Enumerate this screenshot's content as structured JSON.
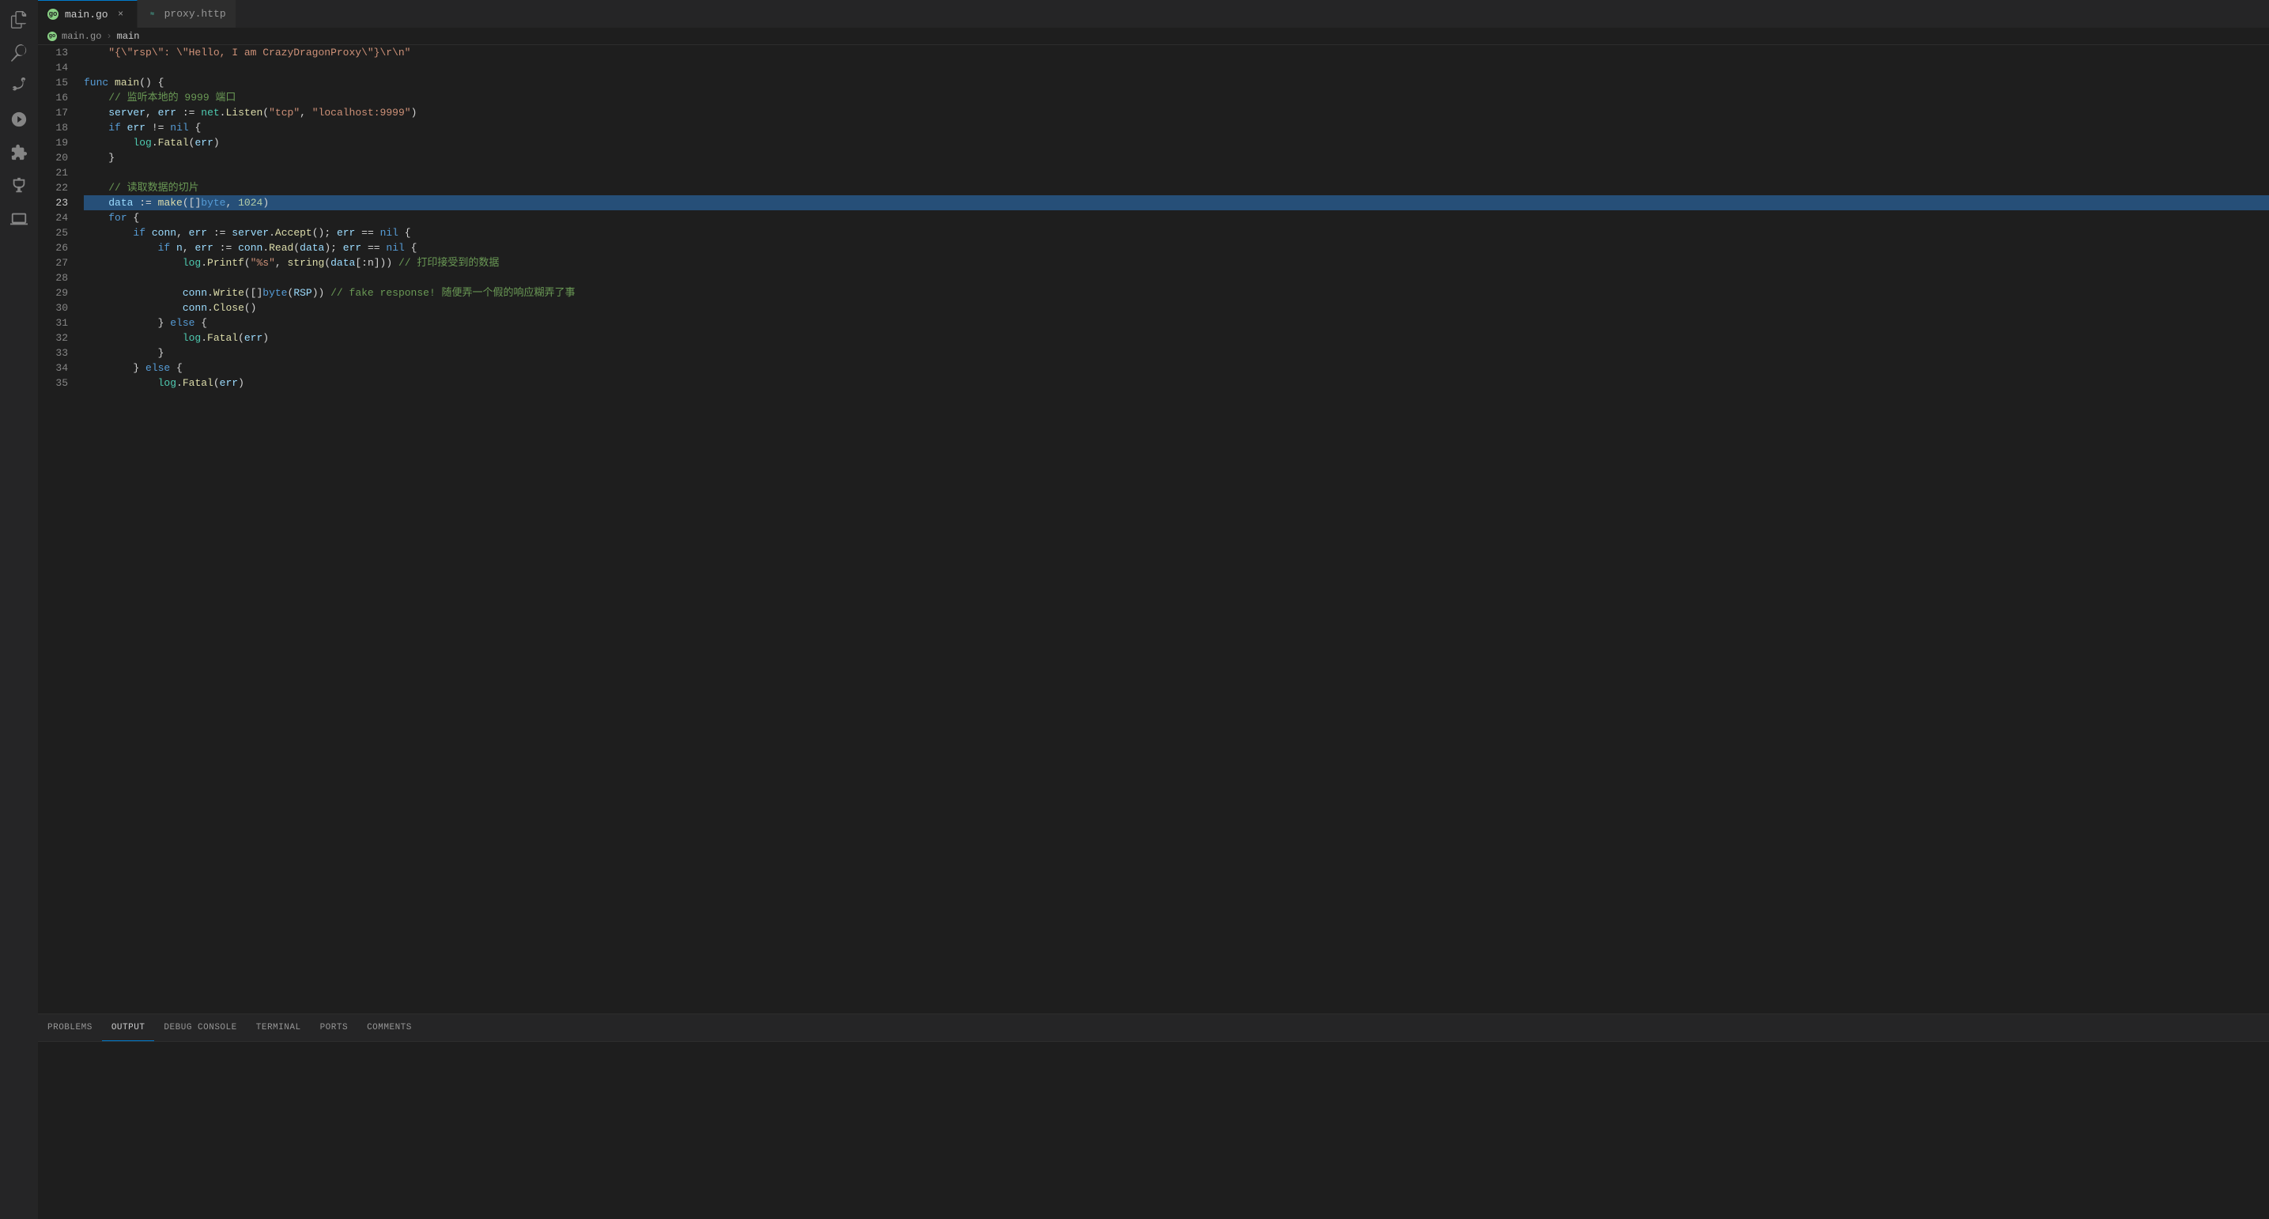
{
  "activityBar": {
    "icons": [
      {
        "name": "files-icon",
        "label": "Explorer",
        "active": false
      },
      {
        "name": "search-icon",
        "label": "Search",
        "active": false
      },
      {
        "name": "source-control-icon",
        "label": "Source Control",
        "active": false
      },
      {
        "name": "run-icon",
        "label": "Run and Debug",
        "active": false
      },
      {
        "name": "extensions-icon",
        "label": "Extensions",
        "active": false
      },
      {
        "name": "testing-icon",
        "label": "Testing",
        "active": false
      },
      {
        "name": "remote-icon",
        "label": "Remote Explorer",
        "active": false
      }
    ]
  },
  "tabs": [
    {
      "id": "main-go",
      "label": "main.go",
      "icon": "go-icon",
      "active": true,
      "closable": true
    },
    {
      "id": "proxy-http",
      "label": "proxy.http",
      "icon": "http-icon",
      "active": false,
      "closable": false
    }
  ],
  "breadcrumb": {
    "items": [
      "main.go",
      "main"
    ]
  },
  "editor": {
    "lines": [
      {
        "num": 13,
        "content": "    \"{\\\"rsp\\\": \\\"Hello, I am CrazyDragonProxy\\\"}\\r\\n\"",
        "type": "string-line"
      },
      {
        "num": 14,
        "content": ""
      },
      {
        "num": 15,
        "content": "func main() {",
        "type": "func-decl"
      },
      {
        "num": 16,
        "content": "    // 监听本地的 9999 端口",
        "type": "comment"
      },
      {
        "num": 17,
        "content": "    server, err := net.Listen(\"tcp\", \"localhost:9999\")",
        "type": "code"
      },
      {
        "num": 18,
        "content": "    if err != nil {",
        "type": "code"
      },
      {
        "num": 19,
        "content": "        log.Fatal(err)",
        "type": "code"
      },
      {
        "num": 20,
        "content": "    }",
        "type": "code"
      },
      {
        "num": 21,
        "content": ""
      },
      {
        "num": 22,
        "content": "    // 读取数据的切片",
        "type": "comment"
      },
      {
        "num": 23,
        "content": "    data := make([]byte, 1024)",
        "type": "code",
        "highlighted": true
      },
      {
        "num": 24,
        "content": "    for {",
        "type": "code"
      },
      {
        "num": 25,
        "content": "        if conn, err := server.Accept(); err == nil {",
        "type": "code"
      },
      {
        "num": 26,
        "content": "            if n, err := conn.Read(data); err == nil {",
        "type": "code"
      },
      {
        "num": 27,
        "content": "                log.Printf(\"%s\", string(data[:n])) // 打印接受到的数据",
        "type": "code-comment"
      },
      {
        "num": 28,
        "content": ""
      },
      {
        "num": 29,
        "content": "                conn.Write([]byte(RSP)) // fake response! 随便弄一个假的响应糊弄了事",
        "type": "code-comment"
      },
      {
        "num": 30,
        "content": "                conn.Close()",
        "type": "code"
      },
      {
        "num": 31,
        "content": "            } else {",
        "type": "code"
      },
      {
        "num": 32,
        "content": "                log.Fatal(err)",
        "type": "code"
      },
      {
        "num": 33,
        "content": "            }",
        "type": "code"
      },
      {
        "num": 34,
        "content": "        } else {",
        "type": "code"
      },
      {
        "num": 35,
        "content": "            log.Fatal(err)",
        "type": "code"
      }
    ]
  },
  "panelTabs": [
    {
      "id": "problems",
      "label": "PROBLEMS",
      "active": false
    },
    {
      "id": "output",
      "label": "OUTPUT",
      "active": true
    },
    {
      "id": "debug-console",
      "label": "DEBUG CONSOLE",
      "active": false
    },
    {
      "id": "terminal",
      "label": "TERMINAL",
      "active": false
    },
    {
      "id": "ports",
      "label": "PORTS",
      "active": false
    },
    {
      "id": "comments",
      "label": "COMMENTS",
      "active": false
    }
  ],
  "colors": {
    "background": "#1e1e1e",
    "sidebar": "#252526",
    "activeTab": "#1e1e1e",
    "inactiveTab": "#2d2d2d",
    "accent": "#007acc",
    "keyword": "#569cd6",
    "function": "#dcdcaa",
    "string": "#ce9178",
    "comment": "#6a9955",
    "type": "#4ec9b0",
    "variable": "#9cdcfe"
  }
}
